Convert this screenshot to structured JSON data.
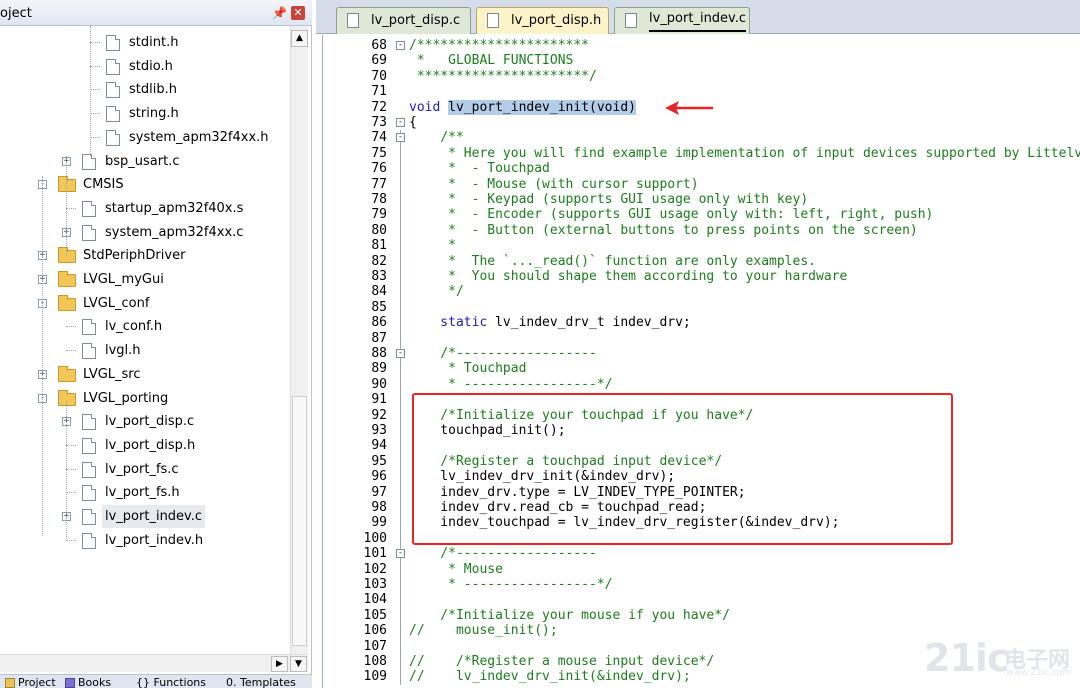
{
  "project_panel": {
    "title": "oject",
    "pin_glyph": "📌",
    "close_glyph": "✕",
    "tree": [
      {
        "label": "stdint.h",
        "type": "file",
        "depth": 4
      },
      {
        "label": "stdio.h",
        "type": "file",
        "depth": 4
      },
      {
        "label": "stdlib.h",
        "type": "file",
        "depth": 4
      },
      {
        "label": "string.h",
        "type": "file",
        "depth": 4
      },
      {
        "label": "system_apm32f4xx.h",
        "type": "file",
        "depth": 4
      },
      {
        "label": "bsp_usart.c",
        "type": "file",
        "depth": 3,
        "expander": "+"
      },
      {
        "label": "CMSIS",
        "type": "folder",
        "depth": 2,
        "expander": "−"
      },
      {
        "label": "startup_apm32f40x.s",
        "type": "file",
        "depth": 3
      },
      {
        "label": "system_apm32f4xx.c",
        "type": "file",
        "depth": 3,
        "expander": "+"
      },
      {
        "label": "StdPeriphDriver",
        "type": "folder",
        "depth": 2,
        "expander": "+"
      },
      {
        "label": "LVGL_myGui",
        "type": "folder",
        "depth": 2,
        "expander": "+"
      },
      {
        "label": "LVGL_conf",
        "type": "folder",
        "depth": 2,
        "expander": "−"
      },
      {
        "label": "lv_conf.h",
        "type": "file",
        "depth": 3
      },
      {
        "label": "lvgl.h",
        "type": "file",
        "depth": 3
      },
      {
        "label": "LVGL_src",
        "type": "folder",
        "depth": 2,
        "expander": "+"
      },
      {
        "label": "LVGL_porting",
        "type": "folder",
        "depth": 2,
        "expander": "−"
      },
      {
        "label": "lv_port_disp.c",
        "type": "file",
        "depth": 3,
        "expander": "+"
      },
      {
        "label": "lv_port_disp.h",
        "type": "file",
        "depth": 3
      },
      {
        "label": "lv_port_fs.c",
        "type": "file",
        "depth": 3
      },
      {
        "label": "lv_port_fs.h",
        "type": "file",
        "depth": 3
      },
      {
        "label": "lv_port_indev.c",
        "type": "file",
        "depth": 3,
        "expander": "+",
        "selected": true
      },
      {
        "label": "lv_port_indev.h",
        "type": "file",
        "depth": 3
      }
    ],
    "bottom_tabs": [
      "Project",
      "Books",
      "{} Functions",
      "0. Templates"
    ]
  },
  "editor_tabs": [
    {
      "label": "lv_port_disp.c",
      "style": "green"
    },
    {
      "label": "lv_port_disp.h",
      "style": "yellow"
    },
    {
      "label": "lv_port_indev.c",
      "style": "green",
      "active": true
    }
  ],
  "code_lines": [
    {
      "n": "68",
      "fold": "−",
      "segs": [
        {
          "t": "/**********************",
          "c": "comment"
        }
      ]
    },
    {
      "n": "69",
      "segs": [
        {
          "t": " *   GLOBAL FUNCTIONS",
          "c": "comment"
        }
      ]
    },
    {
      "n": "70",
      "segs": [
        {
          "t": " **********************/",
          "c": "comment"
        }
      ]
    },
    {
      "n": "71",
      "segs": []
    },
    {
      "n": "72",
      "segs": [
        {
          "t": "void ",
          "c": "kw"
        },
        {
          "t": "lv_port_indev_init(void)",
          "c": "plain",
          "hl": true
        }
      ]
    },
    {
      "n": "73",
      "fold": "−",
      "segs": [
        {
          "t": "{",
          "c": "plain"
        }
      ]
    },
    {
      "n": "74",
      "fold": "−",
      "segs": [
        {
          "t": "    /**",
          "c": "comment"
        }
      ]
    },
    {
      "n": "75",
      "segs": [
        {
          "t": "     * Here you will find example implementation of input devices supported by LittelvGL:",
          "c": "comment"
        }
      ]
    },
    {
      "n": "76",
      "segs": [
        {
          "t": "     *  - Touchpad",
          "c": "comment"
        }
      ]
    },
    {
      "n": "77",
      "segs": [
        {
          "t": "     *  - Mouse (with cursor support)",
          "c": "comment"
        }
      ]
    },
    {
      "n": "78",
      "segs": [
        {
          "t": "     *  - Keypad (supports GUI usage only with key)",
          "c": "comment"
        }
      ]
    },
    {
      "n": "79",
      "segs": [
        {
          "t": "     *  - Encoder (supports GUI usage only with: left, right, push)",
          "c": "comment"
        }
      ]
    },
    {
      "n": "80",
      "segs": [
        {
          "t": "     *  - Button (external buttons to press points on the screen)",
          "c": "comment"
        }
      ]
    },
    {
      "n": "81",
      "segs": [
        {
          "t": "     *",
          "c": "comment"
        }
      ]
    },
    {
      "n": "82",
      "segs": [
        {
          "t": "     *  The `..._read()` function are only examples.",
          "c": "comment"
        }
      ]
    },
    {
      "n": "83",
      "segs": [
        {
          "t": "     *  You should shape them according to your hardware",
          "c": "comment"
        }
      ]
    },
    {
      "n": "84",
      "segs": [
        {
          "t": "     */",
          "c": "comment"
        }
      ]
    },
    {
      "n": "85",
      "segs": []
    },
    {
      "n": "86",
      "segs": [
        {
          "t": "    static ",
          "c": "kw"
        },
        {
          "t": "lv_indev_drv_t indev_drv;",
          "c": "plain"
        }
      ]
    },
    {
      "n": "87",
      "segs": []
    },
    {
      "n": "88",
      "fold": "−",
      "segs": [
        {
          "t": "    /*------------------",
          "c": "comment"
        }
      ]
    },
    {
      "n": "89",
      "segs": [
        {
          "t": "     * Touchpad",
          "c": "comment"
        }
      ]
    },
    {
      "n": "90",
      "segs": [
        {
          "t": "     * -----------------*/",
          "c": "comment"
        }
      ]
    },
    {
      "n": "91",
      "segs": []
    },
    {
      "n": "92",
      "segs": [
        {
          "t": "    /*Initialize your touchpad if you have*/",
          "c": "comment"
        }
      ]
    },
    {
      "n": "93",
      "segs": [
        {
          "t": "    touchpad_init();",
          "c": "plain"
        }
      ]
    },
    {
      "n": "94",
      "segs": []
    },
    {
      "n": "95",
      "segs": [
        {
          "t": "    /*Register a touchpad input device*/",
          "c": "comment"
        }
      ]
    },
    {
      "n": "96",
      "segs": [
        {
          "t": "    lv_indev_drv_init(&indev_drv);",
          "c": "plain"
        }
      ]
    },
    {
      "n": "97",
      "segs": [
        {
          "t": "    indev_drv.type = LV_INDEV_TYPE_POINTER;",
          "c": "plain"
        }
      ]
    },
    {
      "n": "98",
      "segs": [
        {
          "t": "    indev_drv.read_cb = touchpad_read;",
          "c": "plain"
        }
      ]
    },
    {
      "n": "99",
      "segs": [
        {
          "t": "    indev_touchpad = lv_indev_drv_register(&indev_drv);",
          "c": "plain"
        }
      ]
    },
    {
      "n": "100",
      "segs": []
    },
    {
      "n": "101",
      "fold": "−",
      "segs": [
        {
          "t": "    /*------------------",
          "c": "comment"
        }
      ]
    },
    {
      "n": "102",
      "segs": [
        {
          "t": "     * Mouse",
          "c": "comment"
        }
      ]
    },
    {
      "n": "103",
      "segs": [
        {
          "t": "     * -----------------*/",
          "c": "comment"
        }
      ]
    },
    {
      "n": "104",
      "segs": []
    },
    {
      "n": "105",
      "segs": [
        {
          "t": "    /*Initialize your mouse if you have*/",
          "c": "comment"
        }
      ]
    },
    {
      "n": "106",
      "segs": [
        {
          "t": "//    mouse_init();",
          "c": "comment"
        }
      ]
    },
    {
      "n": "107",
      "segs": []
    },
    {
      "n": "108",
      "segs": [
        {
          "t": "//    /*Register a mouse input device*/",
          "c": "comment"
        }
      ]
    },
    {
      "n": "109",
      "segs": [
        {
          "t": "//    lv_indev_drv_init(&indev_drv);",
          "c": "comment"
        }
      ]
    }
  ],
  "watermark": {
    "main": "21ic",
    "cn": "电子网",
    "url": "www.21ic.com"
  },
  "colors": {
    "comment": "#1d7d1d",
    "keyword": "#1c1cb8",
    "highlight": "#b3cde8",
    "annotation": "#e42626"
  }
}
